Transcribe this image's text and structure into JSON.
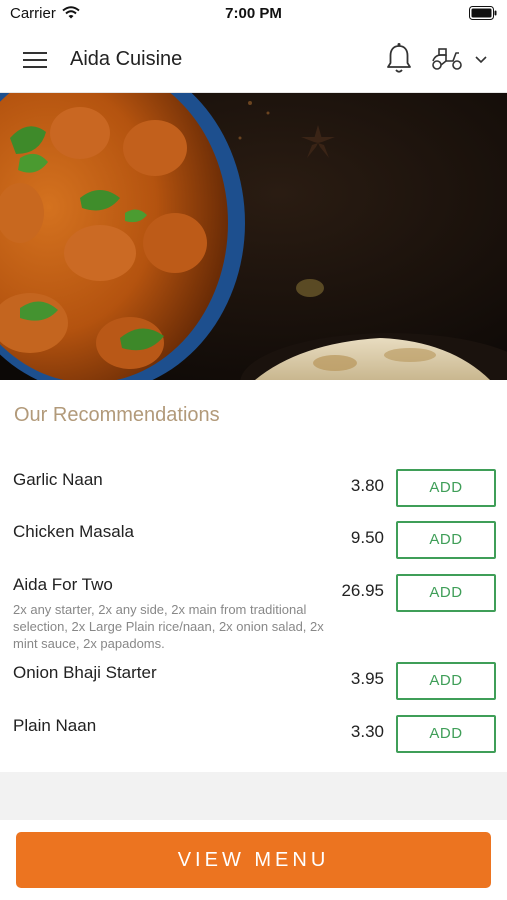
{
  "status_bar": {
    "carrier": "Carrier",
    "time": "7:00 PM"
  },
  "nav": {
    "title": "Aida Cuisine",
    "menu_icon": "hamburger-menu-icon",
    "bell_icon": "bell-icon",
    "delivery_icon": "scooter-delivery-icon",
    "chevron_icon": "chevron-down-icon"
  },
  "hero": {
    "description": "food-banner-image"
  },
  "recommendations": {
    "title": "Our Recommendations",
    "add_label": "ADD",
    "items": [
      {
        "name": "Garlic Naan",
        "price": "3.80",
        "description": ""
      },
      {
        "name": "Chicken Masala",
        "price": "9.50",
        "description": ""
      },
      {
        "name": "Aida For Two",
        "price": "26.95",
        "description": "2x any starter, 2x any side, 2x main from traditional selection, 2x Large Plain rice/naan, 2x onion salad, 2x mint sauce, 2x papadoms."
      },
      {
        "name": "Onion Bhaji Starter",
        "price": "3.95",
        "description": ""
      },
      {
        "name": "Plain Naan",
        "price": "3.30",
        "description": ""
      }
    ]
  },
  "footer": {
    "view_menu_label": "VIEW MENU"
  },
  "colors": {
    "accent_orange": "#ec7420",
    "add_green": "#3f9e58",
    "section_title": "#b29a7a"
  }
}
